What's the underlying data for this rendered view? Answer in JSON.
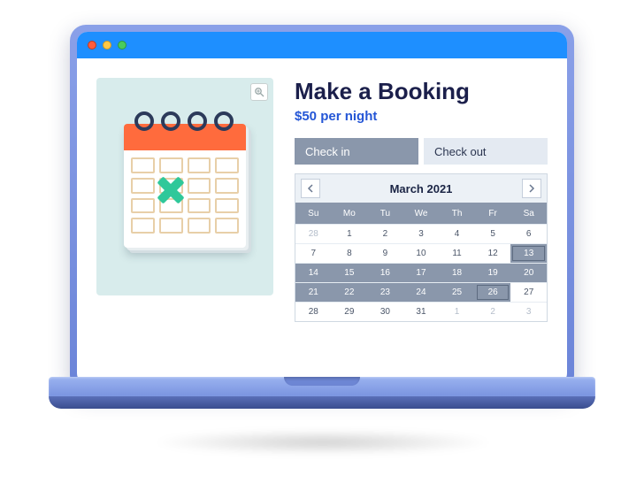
{
  "booking": {
    "title": "Make a Booking",
    "price": "$50 per night"
  },
  "tabs": {
    "checkin": "Check in",
    "checkout": "Check out"
  },
  "calendar": {
    "month_label": "March 2021",
    "dow": [
      "Su",
      "Mo",
      "Tu",
      "We",
      "Th",
      "Fr",
      "Sa"
    ],
    "weeks": [
      [
        {
          "n": "28",
          "muted": true
        },
        {
          "n": "1"
        },
        {
          "n": "2"
        },
        {
          "n": "3"
        },
        {
          "n": "4"
        },
        {
          "n": "5"
        },
        {
          "n": "6"
        }
      ],
      [
        {
          "n": "7"
        },
        {
          "n": "8"
        },
        {
          "n": "9"
        },
        {
          "n": "10"
        },
        {
          "n": "11"
        },
        {
          "n": "12"
        },
        {
          "n": "13",
          "sel": true,
          "box": true
        }
      ],
      [
        {
          "n": "14",
          "sel": true
        },
        {
          "n": "15",
          "sel": true
        },
        {
          "n": "16",
          "sel": true
        },
        {
          "n": "17",
          "sel": true
        },
        {
          "n": "18",
          "sel": true
        },
        {
          "n": "19",
          "sel": true
        },
        {
          "n": "20",
          "sel": true
        }
      ],
      [
        {
          "n": "21",
          "sel": true
        },
        {
          "n": "22",
          "sel": true
        },
        {
          "n": "23",
          "sel": true
        },
        {
          "n": "24",
          "sel": true
        },
        {
          "n": "25",
          "sel": true
        },
        {
          "n": "26",
          "sel": true,
          "box": true
        },
        {
          "n": "27"
        }
      ],
      [
        {
          "n": "28"
        },
        {
          "n": "29"
        },
        {
          "n": "30"
        },
        {
          "n": "31"
        },
        {
          "n": "1",
          "muted": true
        },
        {
          "n": "2",
          "muted": true
        },
        {
          "n": "3",
          "muted": true
        }
      ]
    ]
  }
}
